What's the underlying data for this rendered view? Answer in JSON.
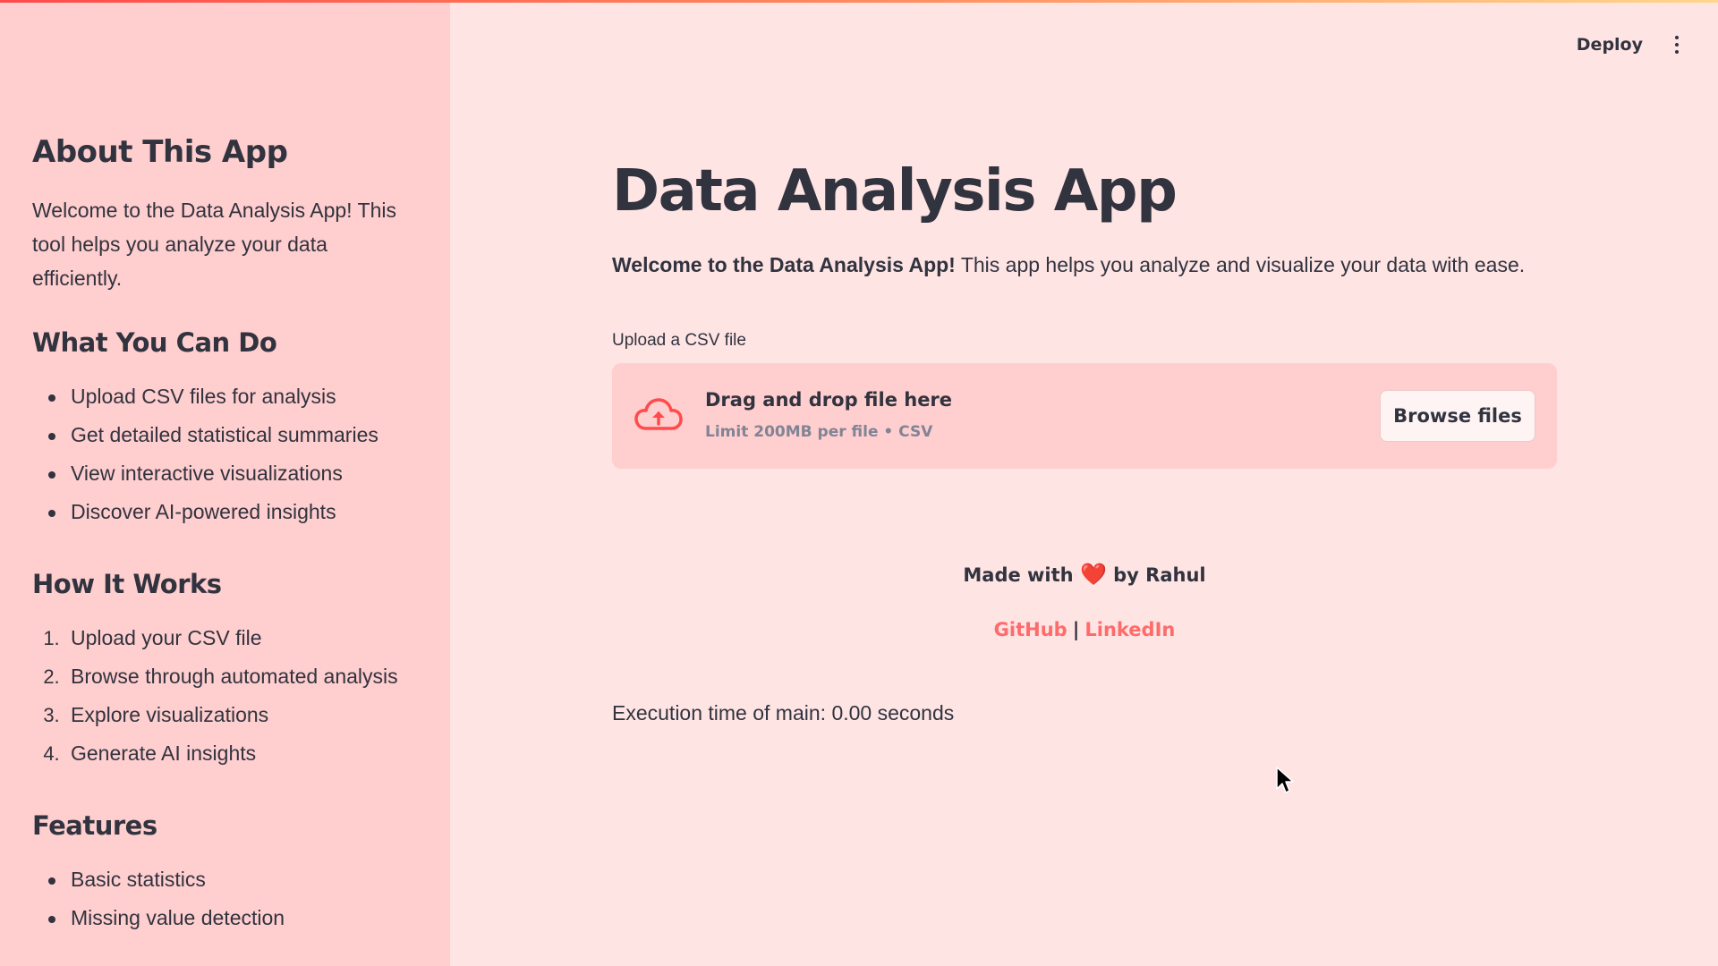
{
  "sidebar": {
    "about_title": "About This App",
    "about_text": "Welcome to the Data Analysis App! This tool helps you analyze your data efficiently.",
    "what_title": "What You Can Do",
    "what_items": [
      "Upload CSV files for analysis",
      "Get detailed statistical summaries",
      "View interactive visualizations",
      "Discover AI-powered insights"
    ],
    "how_title": "How It Works",
    "how_items": [
      {
        "num": "1.",
        "label": "Upload your CSV file"
      },
      {
        "num": "2.",
        "label": "Browse through automated analysis"
      },
      {
        "num": "3.",
        "label": "Explore visualizations"
      },
      {
        "num": "4.",
        "label": "Generate AI insights"
      }
    ],
    "features_title": "Features",
    "features_items": [
      "Basic statistics",
      "Missing value detection"
    ]
  },
  "header": {
    "deploy_label": "Deploy",
    "menu_icon": "kebab-menu-icon"
  },
  "main": {
    "title": "Data Analysis App",
    "welcome_bold": "Welcome to the Data Analysis App!",
    "welcome_rest": " This app helps you analyze and visualize your data with ease.",
    "uploader": {
      "label": "Upload a CSV file",
      "drop_title": "Drag and drop file here",
      "drop_sub": "Limit 200MB per file • CSV",
      "browse_label": "Browse files",
      "icon": "cloud-upload-icon"
    },
    "credit_prefix": "Made with",
    "credit_heart": "❤️",
    "credit_suffix": "by Rahul",
    "links": {
      "github": "GitHub",
      "separator": "|",
      "linkedin": "LinkedIn"
    },
    "exec_time": "Execution time of main: 0.00 seconds"
  },
  "colors": {
    "sidebar_bg": "#ffcece",
    "main_bg": "#ffe4e4",
    "accent": "#ff4b4b",
    "link": "#ff6b6b",
    "text": "#31333f"
  }
}
